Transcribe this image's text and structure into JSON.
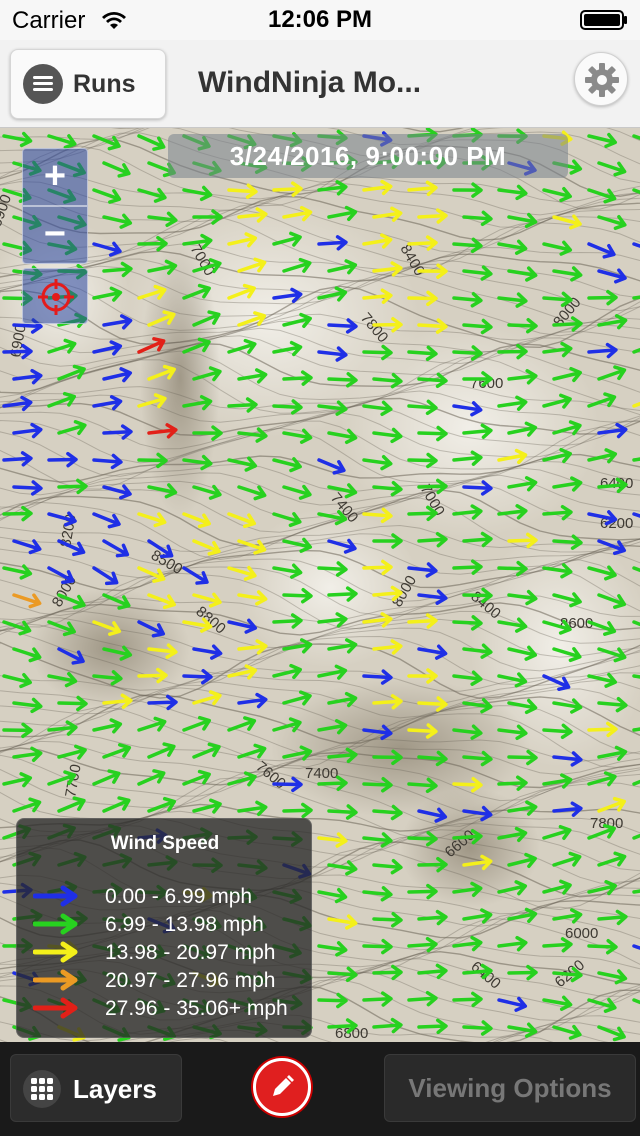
{
  "status_bar": {
    "carrier": "Carrier",
    "time": "12:06 PM"
  },
  "nav": {
    "runs_label": "Runs",
    "title": "WindNinja Mo..."
  },
  "map": {
    "timestamp": "3/24/2016, 9:00:00 PM",
    "zoom_in_label": "+",
    "zoom_out_label": "−",
    "contour_labels": [
      "6900",
      "7000",
      "8400",
      "7800",
      "8000",
      "7600",
      "7400",
      "7000",
      "6400",
      "6200",
      "8500",
      "8800",
      "8400",
      "8000",
      "8600",
      "7600",
      "7400",
      "7800",
      "6600",
      "6400",
      "6000",
      "6200",
      "6800",
      "7700",
      "8000",
      "8200",
      "6900"
    ]
  },
  "legend": {
    "title": "Wind Speed",
    "items": [
      {
        "label": "0.00 - 6.99 mph",
        "color": "#1f2fe6"
      },
      {
        "label": "6.99 - 13.98 mph",
        "color": "#27d11f"
      },
      {
        "label": "13.98 - 20.97 mph",
        "color": "#f4f01a"
      },
      {
        "label": "20.97 - 27.96 mph",
        "color": "#eb9a24"
      },
      {
        "label": "27.96 - 35.06+ mph",
        "color": "#e22018"
      }
    ]
  },
  "toolbar": {
    "layers_label": "Layers",
    "viewing_options_label": "Viewing Options"
  },
  "colors": {
    "calm": "#1f2fe6",
    "light": "#27d11f",
    "moderate": "#f4f01a",
    "strong": "#eb9a24",
    "extreme": "#e22018",
    "edit_button": "#e01f1f"
  },
  "icons": {
    "wifi": "wifi-icon",
    "battery": "battery-icon",
    "menu": "hamburger-menu-icon",
    "settings": "gear-icon",
    "locate": "crosshair-target-icon",
    "layers": "grid-icon",
    "edit": "pencil-icon"
  }
}
